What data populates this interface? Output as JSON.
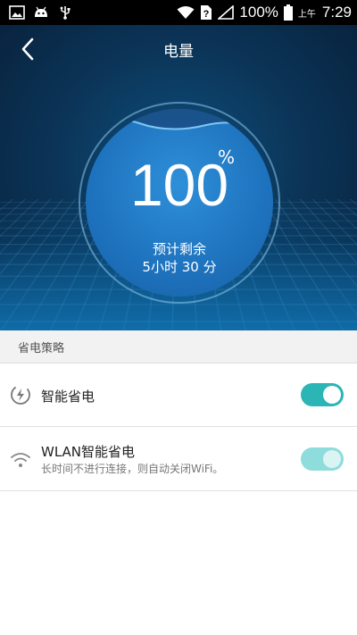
{
  "status_bar": {
    "battery_percent": "100%",
    "ampm": "上午",
    "time": "7:29",
    "left_icons": [
      "image-icon",
      "android-icon",
      "usb-icon"
    ],
    "right_icons": [
      "wifi-icon",
      "sim-alert-icon",
      "signal-icon",
      "battery-icon"
    ]
  },
  "header": {
    "title": "电量"
  },
  "gauge": {
    "value": "100",
    "unit": "%",
    "remaining_label": "预计剩余",
    "remaining_time": "5小时 30 分"
  },
  "section": {
    "title": "省电策略"
  },
  "settings": [
    {
      "title": "智能省电",
      "subtitle": "",
      "icon": "power-saving-icon",
      "enabled": true
    },
    {
      "title": "WLAN智能省电",
      "subtitle": "长时间不进行连接，则自动关闭WiFi。",
      "icon": "wifi-icon",
      "enabled": true
    }
  ],
  "colors": {
    "accent": "#2bb5b5",
    "accent_dim": "#8fdcdc",
    "gauge_fill": "#1e72bd",
    "hero_bg": "#0b3457"
  }
}
